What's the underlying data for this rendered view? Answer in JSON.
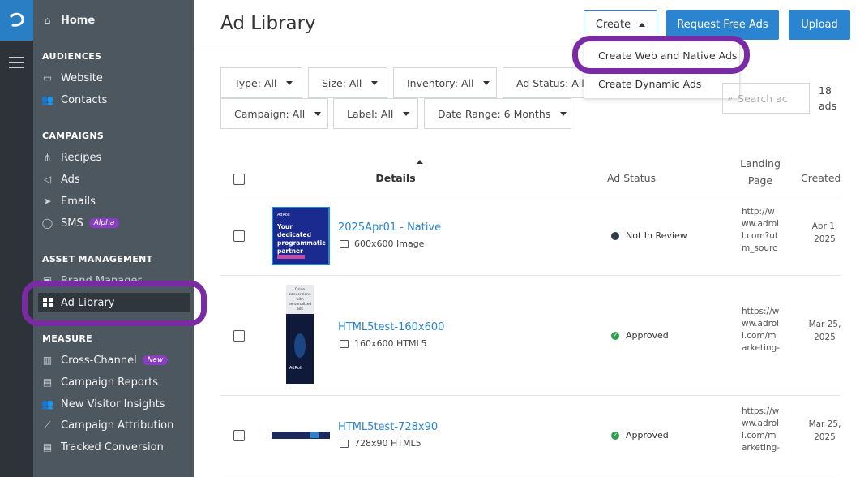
{
  "sidebar": {
    "home": "Home",
    "sections": {
      "audiences": "AUDIENCES",
      "campaigns": "CAMPAIGNS",
      "asset_management": "ASSET MANAGEMENT",
      "measure": "MEASURE"
    },
    "items": {
      "website": "Website",
      "contacts": "Contacts",
      "recipes": "Recipes",
      "ads": "Ads",
      "emails": "Emails",
      "sms": "SMS",
      "sms_badge": "Alpha",
      "brand_manager": "Brand Manager",
      "ad_library": "Ad Library",
      "cross_channel": "Cross-Channel",
      "cross_channel_badge": "New",
      "campaign_reports": "Campaign Reports",
      "new_visitor_insights": "New Visitor Insights",
      "campaign_attribution": "Campaign Attribution",
      "tracked_conversion": "Tracked Conversion"
    }
  },
  "header": {
    "title": "Ad Library",
    "create_label": "Create",
    "request_label": "Request Free Ads",
    "upload_label": "Upload"
  },
  "create_menu": {
    "item1": "Create Web and Native Ads",
    "item2": "Create Dynamic Ads"
  },
  "filters": {
    "type": "Type: All",
    "size": "Size: All",
    "inventory": "Inventory: All",
    "ad_status": "Ad Status: All",
    "campaign": "Campaign: All",
    "label": "Label: All",
    "date_range": "Date Range: 6 Months"
  },
  "search": {
    "placeholder": "Search ac"
  },
  "ad_count": "18 ads",
  "table": {
    "headers": {
      "details": "Details",
      "ad_status": "Ad Status",
      "landing_page": "Landing Page",
      "created": "Created"
    },
    "rows": [
      {
        "name": "2025Apr01 - Native",
        "meta": "600x600 Image",
        "status": "Not In Review",
        "landing": "http://www.adroll.com?utm_sourc",
        "created": "Apr 1, 2025",
        "thumb_text": "Your dedicated programmatic partner",
        "thumb_logo": "AdRoll"
      },
      {
        "name": "HTML5test-160x600",
        "meta": "160x600 HTML5",
        "status": "Approved",
        "landing": "https://www.adroll.com/marketing-",
        "created": "Mar 25, 2025",
        "thumb_text": "Drive conversions with personalized ads",
        "thumb_logo": "AdRoll"
      },
      {
        "name": "HTML5test-728x90",
        "meta": "728x90 HTML5",
        "status": "Approved",
        "landing": "https://www.adroll.com/marketing-",
        "created": "Mar 25, 2025"
      }
    ]
  },
  "colors": {
    "accent": "#2a84cf",
    "sidebar": "#4d5760",
    "rail": "#2d3338",
    "highlight": "#7b2aa5",
    "badge": "#8a3cc6",
    "approved": "#2e9e4e",
    "not_in_review": "#2d3a4a"
  }
}
